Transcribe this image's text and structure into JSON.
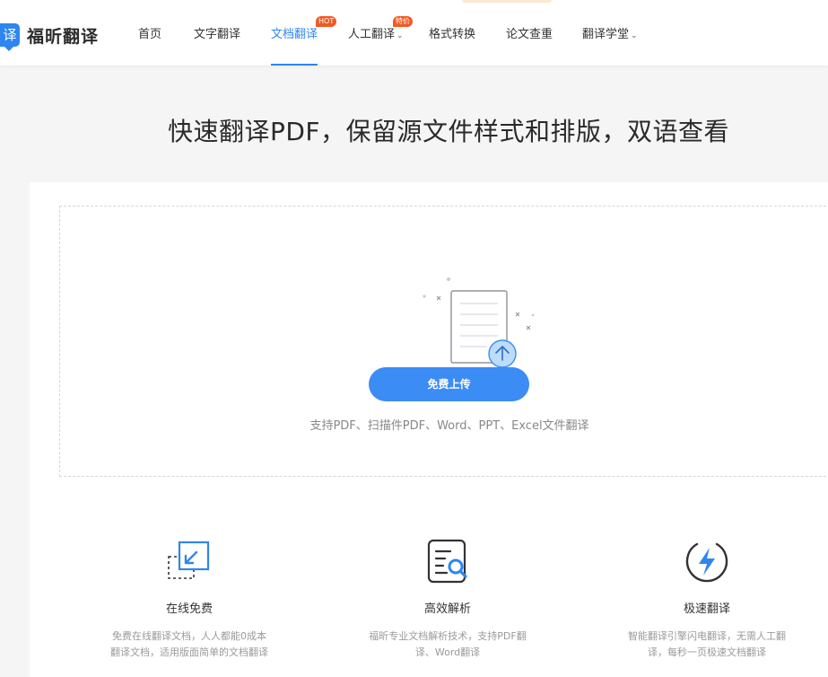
{
  "brand": {
    "logo_mark": "译",
    "name": "福昕翻译"
  },
  "nav": {
    "items": [
      {
        "label": "首页"
      },
      {
        "label": "文字翻译"
      },
      {
        "label": "文档翻译",
        "active": true,
        "badge": "HOT"
      },
      {
        "label": "人工翻译",
        "caret": "⌄",
        "badge": "特价"
      },
      {
        "label": "格式转换"
      },
      {
        "label": "论文查重"
      },
      {
        "label": "翻译学堂",
        "caret": "⌄"
      }
    ]
  },
  "hero": {
    "headline": "快速翻译PDF，保留源文件样式和排版，双语查看"
  },
  "upload": {
    "button_label": "免费上传",
    "support_text": "支持PDF、扫描件PDF、Word、PPT、Excel文件翻译"
  },
  "features": [
    {
      "icon": "online-free-icon",
      "title": "在线免费",
      "desc_line1": "免费在线翻译文档，人人都能0成本",
      "desc_line2": "翻译文档，适用版面简单的文档翻译"
    },
    {
      "icon": "document-search-icon",
      "title": "高效解析",
      "desc_line1": "福昕专业文档解析技术，支持PDF翻",
      "desc_line2": "译、Word翻译"
    },
    {
      "icon": "lightning-icon",
      "title": "极速翻译",
      "desc_line1": "智能翻译引擎闪电翻译，无需人工翻",
      "desc_line2": "译，每秒一页极速文档翻译"
    }
  ],
  "colors": {
    "accent": "#3b8cf5",
    "badge": "#f05a23",
    "page_bg": "#f5f5f5"
  }
}
